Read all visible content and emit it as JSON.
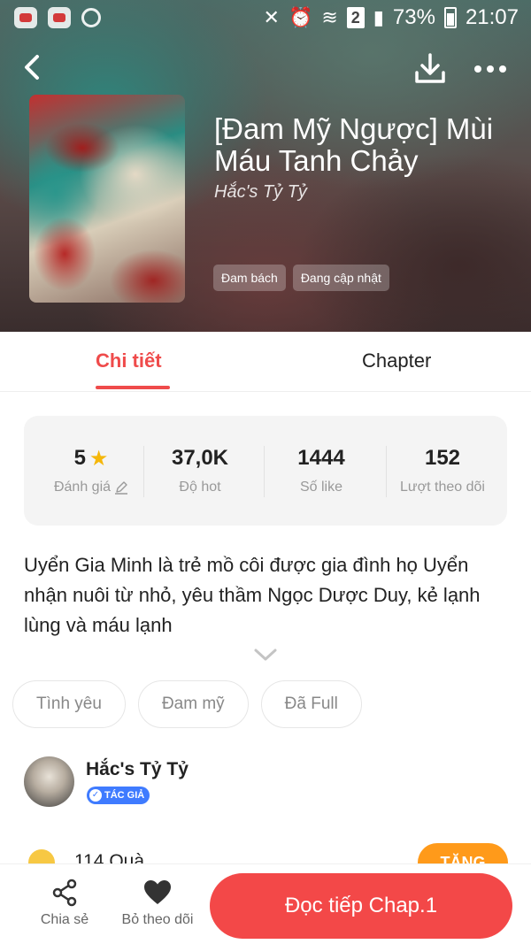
{
  "status_bar": {
    "battery": "73%",
    "time": "21:07",
    "sim_slot": "2"
  },
  "book": {
    "title": "[Đam Mỹ Ngược] Mùi Máu Tanh Chảy",
    "author": "Hắc's Tỷ Tỷ",
    "tags": [
      "Đam bách",
      "Đang cập nhật"
    ]
  },
  "tabs": {
    "detail": "Chi tiết",
    "chapter": "Chapter"
  },
  "stats": [
    {
      "value": "5",
      "label": "Đánh giá"
    },
    {
      "value": "37,0K",
      "label": "Độ hot"
    },
    {
      "value": "1444",
      "label": "Số like"
    },
    {
      "value": "152",
      "label": "Lượt theo dõi"
    }
  ],
  "description": "Uyển Gia Minh là trẻ mồ côi được gia đình họ Uyển nhận nuôi từ nhỏ, yêu thầm Ngọc Dược Duy, kẻ lạnh lùng và máu lạnh",
  "genres": [
    "Tình yêu",
    "Đam mỹ",
    "Đã Full"
  ],
  "author_section": {
    "name": "Hắc's Tỷ Tỷ",
    "badge": "TÁC GIẢ"
  },
  "gifts": {
    "text": "114 Quà",
    "button": "TẶNG"
  },
  "bottom_bar": {
    "share": "Chia sẻ",
    "unfollow": "Bỏ theo dõi",
    "read": "Đọc tiếp Chap.1"
  },
  "colors": {
    "accent": "#ef4b4b",
    "read_button": "#f34848",
    "gift_button": "#ff9a1a",
    "badge": "#3f7bff"
  }
}
